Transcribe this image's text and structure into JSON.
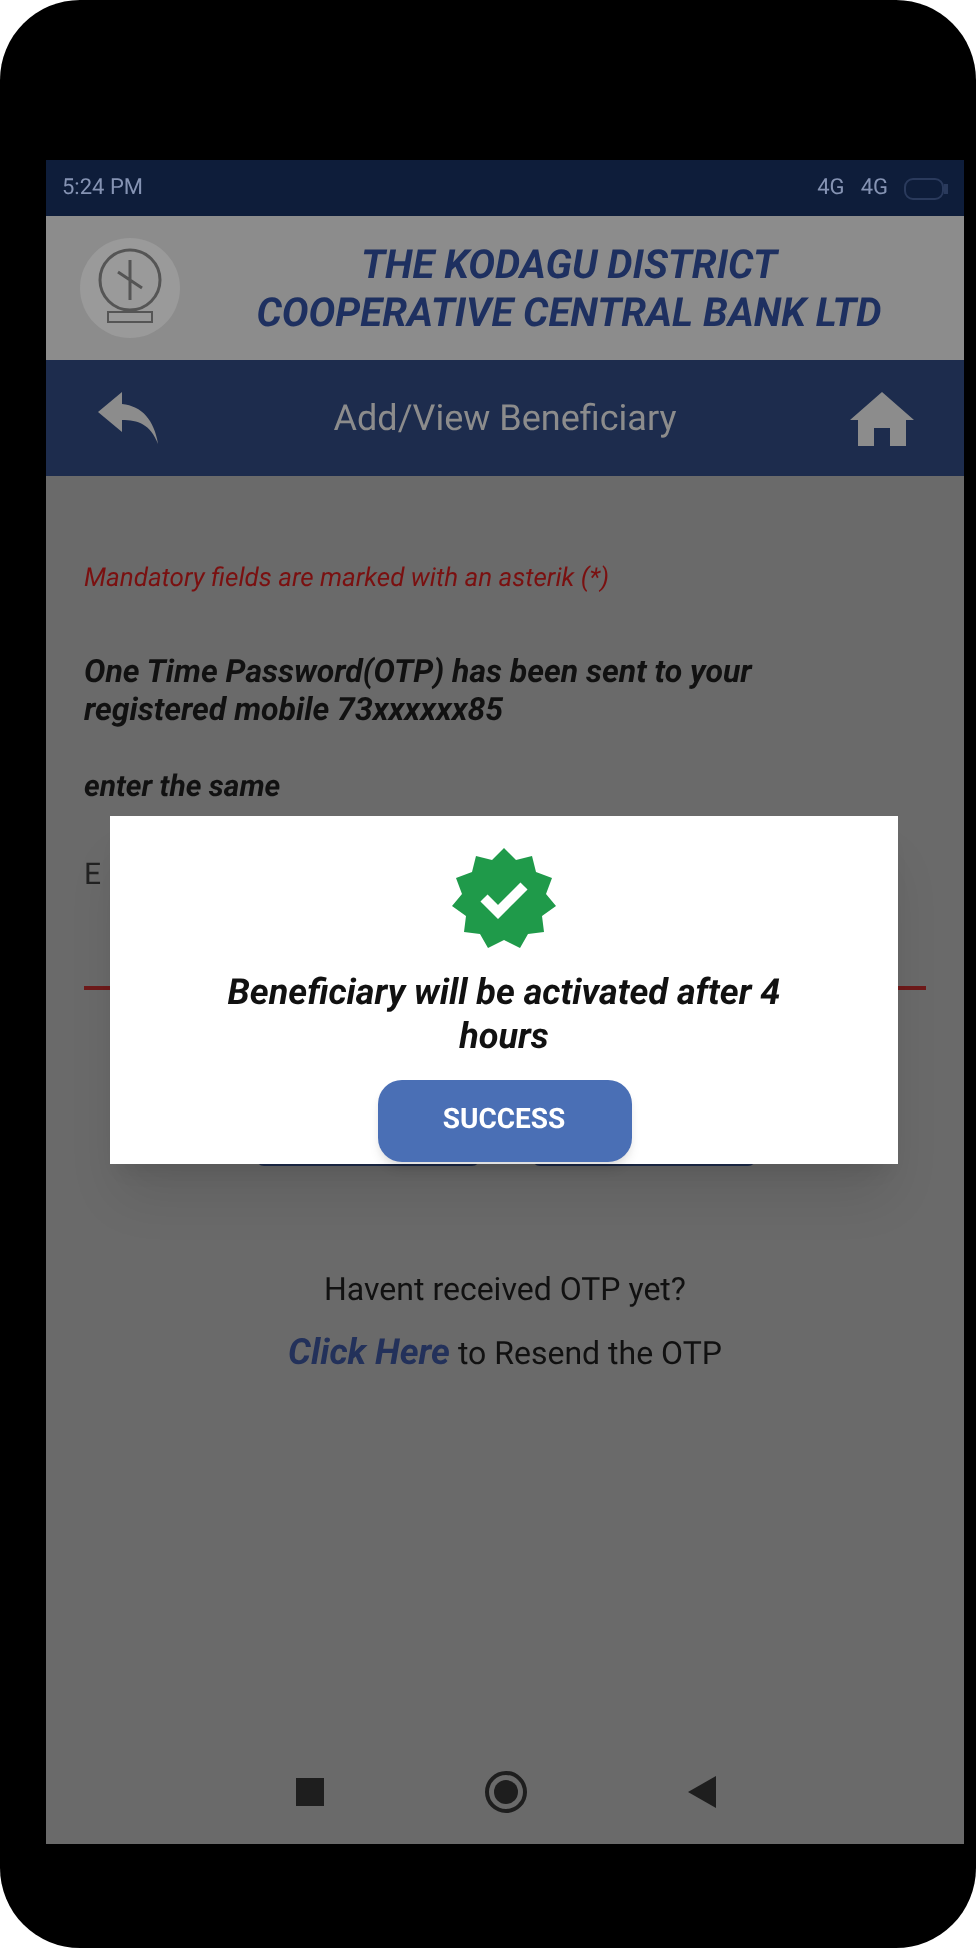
{
  "status_bar": {
    "time": "5:24 PM",
    "network_1": "4G",
    "network_2": "4G"
  },
  "bank_header": {
    "title_line_1": "THE KODAGU DISTRICT",
    "title_line_2": "COOPERATIVE CENTRAL BANK LTD"
  },
  "nav_bar": {
    "title": "Add/View Beneficiary"
  },
  "form": {
    "mandatory_note": "Mandatory fields are marked with an asterik (*)",
    "otp_message": "One Time Password(OTP) has been sent to your registered mobile 73xxxxxx85",
    "enter_prompt": "enter the same",
    "field_label": "E"
  },
  "resend": {
    "question": "Havent received OTP yet?",
    "link": "Click Here",
    "rest": "to Resend the OTP"
  },
  "dialog": {
    "message": "Beneficiary will be activated after 4 hours",
    "button": "SUCCESS"
  }
}
